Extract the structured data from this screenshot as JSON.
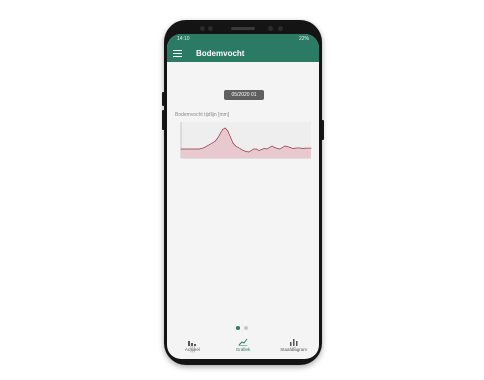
{
  "statusbar": {
    "time": "14:10",
    "battery": "22%"
  },
  "appbar": {
    "title": "Bodemvocht"
  },
  "date_chip": "05/2020 01",
  "chart": {
    "title": "Bodemvocht tijdlijn [mm]"
  },
  "chart_data": {
    "type": "area",
    "x": [
      0,
      1,
      2,
      3,
      4,
      5,
      6,
      7,
      8,
      9,
      10,
      11,
      12,
      13,
      14,
      15,
      16,
      17,
      18,
      19,
      20,
      21,
      22,
      23,
      24,
      25,
      26,
      27,
      28,
      29,
      30,
      31,
      32,
      33,
      34,
      35,
      36,
      37,
      38,
      39,
      40,
      41,
      42,
      43,
      44,
      45,
      46,
      47,
      48,
      49,
      50
    ],
    "values": [
      3,
      3,
      3,
      3,
      3,
      3,
      3,
      3,
      3.2,
      3.5,
      4,
      4.5,
      5,
      5.5,
      6.5,
      8,
      9.5,
      10,
      9,
      7,
      5,
      4,
      3.5,
      3,
      2.5,
      2.2,
      2,
      2.5,
      3,
      3,
      2.5,
      2.8,
      3.2,
      3,
      3.5,
      4,
      3.5,
      3.2,
      3,
      3.5,
      4,
      3.8,
      3.5,
      3.2,
      3.3,
      3.4,
      3.3,
      3.2,
      3.3,
      3.3,
      3.3
    ],
    "ylim": [
      0,
      12
    ],
    "color": "#9b3a4a",
    "fill": "#e8c9cf"
  },
  "pager": {
    "count": 2,
    "active": 0
  },
  "bottom_nav": [
    {
      "label": "Actueel",
      "icon": "gauge-icon"
    },
    {
      "label": "Grafiek",
      "icon": "line-chart-icon"
    },
    {
      "label": "Staafdiagram",
      "icon": "bar-chart-icon"
    }
  ],
  "sysnav": [
    "|||",
    "○",
    "<"
  ],
  "colors": {
    "primary": "#2b7a63"
  }
}
